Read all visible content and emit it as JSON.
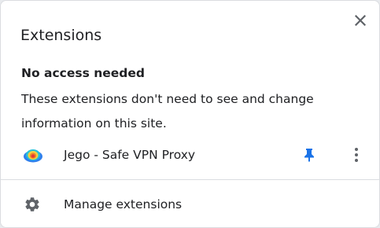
{
  "popup": {
    "title": "Extensions",
    "close_icon": "close-icon"
  },
  "section": {
    "heading": "No access needed",
    "description": "These extensions don't need to see and change information on this site."
  },
  "extensions": [
    {
      "name": "Jego - Safe VPN Proxy",
      "icon": "jego-vpn-icon",
      "pinned": true,
      "pin_icon": "pin-icon",
      "menu_icon": "more-vertical-icon"
    }
  ],
  "footer": {
    "manage_label": "Manage extensions",
    "manage_icon": "gear-icon"
  },
  "colors": {
    "pin_blue": "#1a73e8",
    "icon_gray": "#5f6368",
    "text": "#202124",
    "divider": "#dadce0"
  }
}
